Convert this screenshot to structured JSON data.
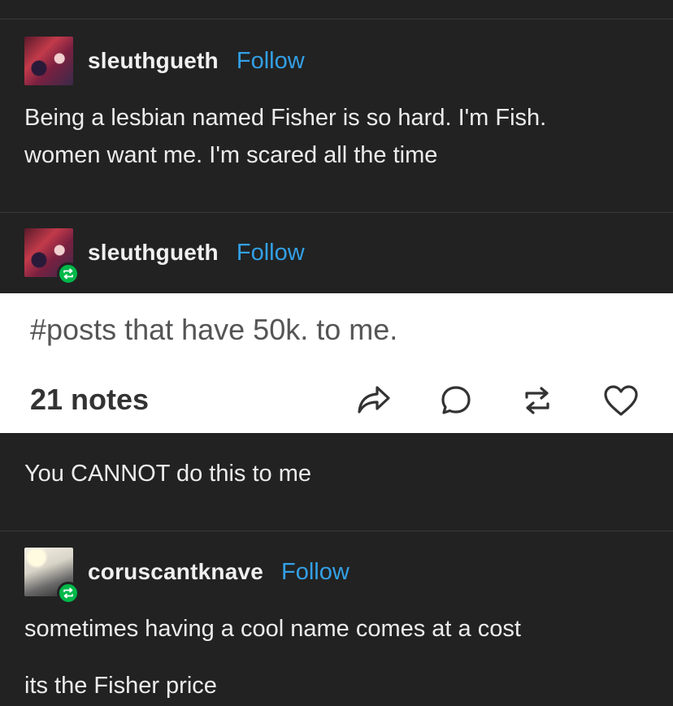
{
  "posts": [
    {
      "username": "sleuthgueth",
      "follow_label": "Follow",
      "avatar_icon": "fox-character-avatar",
      "reblogged": false,
      "lines": [
        "Being a lesbian named Fisher is so hard. I'm Fish.",
        "women want me. I'm scared all the time"
      ]
    },
    {
      "username": "sleuthgueth",
      "follow_label": "Follow",
      "avatar_icon": "fox-character-avatar",
      "reblogged": true,
      "lines": [
        "You CANNOT do this to me"
      ]
    },
    {
      "username": "coruscantknave",
      "follow_label": "Follow",
      "avatar_icon": "sunburst-figure-avatar",
      "reblogged": true,
      "lines": [
        "sometimes having a cool name comes at a cost",
        "its the Fisher price"
      ]
    }
  ],
  "card": {
    "tags": "#posts that have 50k. to me.",
    "notes": "21 notes",
    "actions": [
      "share-icon",
      "reply-icon",
      "reblog-icon",
      "like-icon"
    ]
  },
  "colors": {
    "background": "#222222",
    "follow": "#33a0e6",
    "reblog_badge": "#00b84a",
    "card": "#ffffff"
  }
}
